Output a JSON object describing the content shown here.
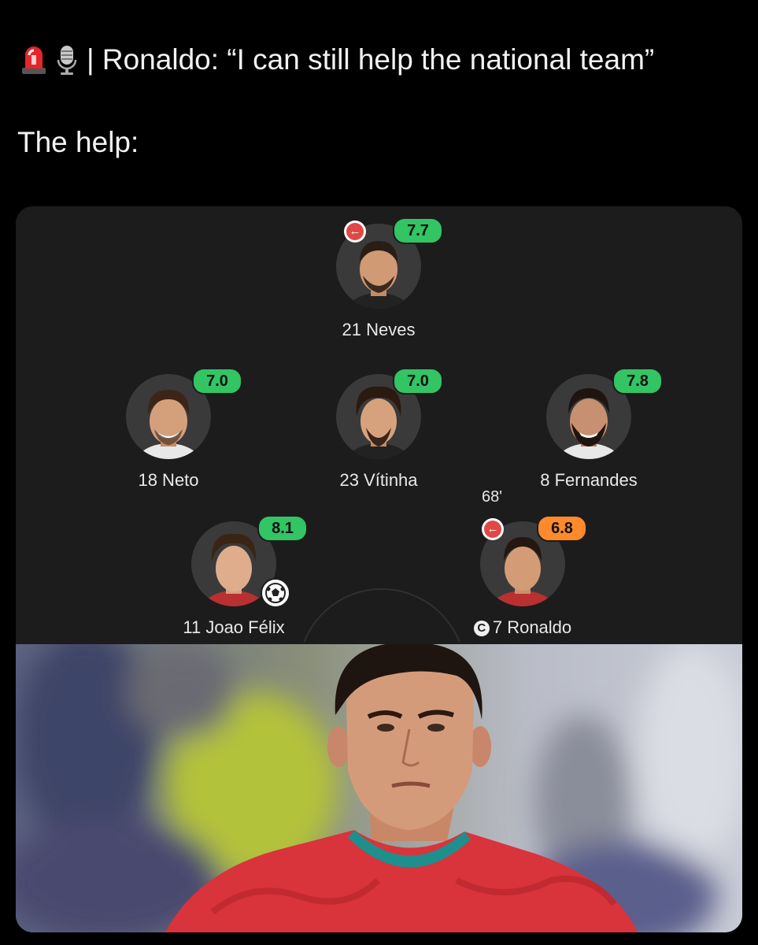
{
  "tweet": {
    "line1_text": "| Ronaldo: “I can still help the national team”",
    "line2_text": "The help:",
    "emoji_icons": [
      "police-light-icon",
      "microphone-icon"
    ]
  },
  "lineup": {
    "players": [
      {
        "number_name": "21 Neves",
        "rating": "7.7",
        "rating_color": "#33c463",
        "subbed_off": true
      },
      {
        "number_name": "18 Neto",
        "rating": "7.0",
        "rating_color": "#33c463"
      },
      {
        "number_name": "23 Vítinha",
        "rating": "7.0",
        "rating_color": "#33c463"
      },
      {
        "number_name": "8 Fernandes",
        "rating": "7.8",
        "rating_color": "#33c463"
      },
      {
        "number_name": "11 Joao Félix",
        "rating": "8.1",
        "rating_color": "#33c463",
        "scored_goal": true
      },
      {
        "number_name": "7 Ronaldo",
        "rating": "6.8",
        "rating_color": "#ff8a2b",
        "subbed_off": true,
        "sub_minute": "68'",
        "captain": true
      }
    ]
  },
  "colors": {
    "background": "#000000",
    "card": "#1c1c1d",
    "good_rating": "#33c463",
    "poor_rating": "#ff8a2b",
    "sub_off": "#e04848"
  },
  "photo_icon": "cristiano-ronaldo-portrait-in-red-portugal-jersey"
}
